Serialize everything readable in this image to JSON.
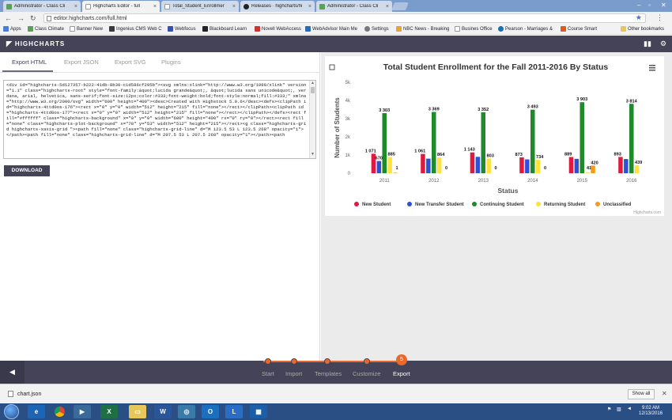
{
  "browser": {
    "tabs": [
      {
        "title": "Administrator - Class Cli",
        "active": false
      },
      {
        "title": "Highcharts Editor - full",
        "active": true
      },
      {
        "title": "Total_Student_Enrollmer",
        "active": false
      },
      {
        "title": "Releases · highcharts/hi",
        "active": false
      },
      {
        "title": "Administrator - Class Cli",
        "active": false
      }
    ],
    "url": "editor.highcharts.com/full.html",
    "bookmarks": [
      "Apps",
      "Class Climate",
      "Banner New",
      "Ingenius CMS Web C",
      "Webfocus",
      "Blackboard Learn",
      "Novell WebAccess",
      "WebAdvisor Main Me",
      "Settings",
      "NBC News - Breaking",
      "Busines Office",
      "Pearson - Marriages &",
      "Course Smart",
      "Other bookmarks"
    ]
  },
  "editor": {
    "brand": "HIGHCHARTS",
    "tabs": [
      "Export HTML",
      "Export JSON",
      "Export SVG",
      "Plugins"
    ],
    "active_tab": "Export HTML",
    "code": "<div id=\"highcharts-5d127357-b222-41db-8b30-c1d586cf295b\"><svg xmlns:xlink=\"http://www.w3.org/1999/xlink\" version=\"1.1\" class=\"highcharts-root\" style=\"font-family:&quot;lucida grande&quot;, &quot;lucida sans unicode&quot;, verdana, arial, helvetica, sans-serif;font-size:12px;color:#333;font-weight:bold;font-style:normal;fill:#333;\" xmlns=\"http://www.w3.org/2000/svg\" width=\"600\" height=\"400\"><desc>Created with Highstock 5.0.6</desc><defs><clipPath id=\"highcharts-4ttd0os-176\"><rect x=\"0\" y=\"0\" width=\"512\" height=\"215\" fill=\"none\"></rect></clipPath><clipPath id=\"highcharts-4ttd0os-177\"><rect x=\"0\" y=\"0\" width=\"512\" height=\"215\" fill=\"none\"></rect></clipPath></defs><rect fill=\"#ffffff\" class=\"highcharts-background\" x=\"0\" y=\"0\" width=\"600\" height=\"400\" rx=\"0\" ry=\"0\"></rect><rect fill=\"none\" class=\"highcharts-plot-background\" x=\"78\" y=\"53\" width=\"512\" height=\"215\"></rect><g class=\"highcharts-grid highcharts-xaxis-grid \"><path fill=\"none\" class=\"highcharts-grid-line\" d=\"M 123.5 53 L 123.5 268\" opacity=\"1\"></path><path fill=\"none\" class=\"highcharts-grid-line\" d=\"M 207.5 53 L 207.5 268\" opacity=\"1\"></path><path",
    "download_label": "DOWNLOAD"
  },
  "stepper": {
    "steps": [
      "Start",
      "Import",
      "Templates",
      "Customize",
      "Export"
    ],
    "active_step": "Export",
    "active_number": "5"
  },
  "download_shelf": {
    "file": "chart.json",
    "show_all": "Show all"
  },
  "taskbar": {
    "time": "9:02 AM",
    "date": "12/13/2016"
  },
  "chart_data": {
    "type": "bar",
    "title": "Total Student Enrollment for the Fall 2011-2016 By Status",
    "xlabel": "Status",
    "ylabel": "Number of Students",
    "categories": [
      "2011",
      "2012",
      "2013",
      "2014",
      "2015",
      "2016"
    ],
    "ylim": [
      0,
      5000
    ],
    "yticks": [
      "0",
      "1k",
      "2k",
      "3k",
      "4k",
      "5k"
    ],
    "grid": false,
    "legend_position": "bottom",
    "credits": "Highcharts.com",
    "series": [
      {
        "name": "New Student",
        "color": "#e0193f",
        "values": [
          1071,
          1061,
          1143,
          873,
          889,
          893
        ],
        "labels": [
          "1 071",
          "1 061",
          "1 143",
          "873",
          "889",
          "893"
        ]
      },
      {
        "name": "New Transfer Student",
        "color": "#2f4fd8",
        "values": [
          670,
          800,
          900,
          760,
          790,
          780
        ],
        "labels": [
          "670",
          "",
          "",
          "",
          "",
          ""
        ]
      },
      {
        "name": "Continuing Student",
        "color": "#1e8a2b",
        "values": [
          3303,
          3369,
          3352,
          3493,
          3903,
          3814
        ],
        "labels": [
          "3 303",
          "3 369",
          "3 352",
          "3 493",
          "3 903",
          "3 814"
        ]
      },
      {
        "name": "Returning Student",
        "color": "#ffe23a",
        "values": [
          885,
          864,
          803,
          734,
          41,
          439
        ],
        "labels": [
          "885",
          "864",
          "803",
          "734",
          "41",
          "439"
        ]
      },
      {
        "name": "Unclassified",
        "color": "#f39c1b",
        "values": [
          1,
          0,
          0,
          0,
          420,
          0
        ],
        "labels": [
          "1",
          "0",
          "0",
          "0",
          "420",
          ""
        ]
      }
    ]
  }
}
